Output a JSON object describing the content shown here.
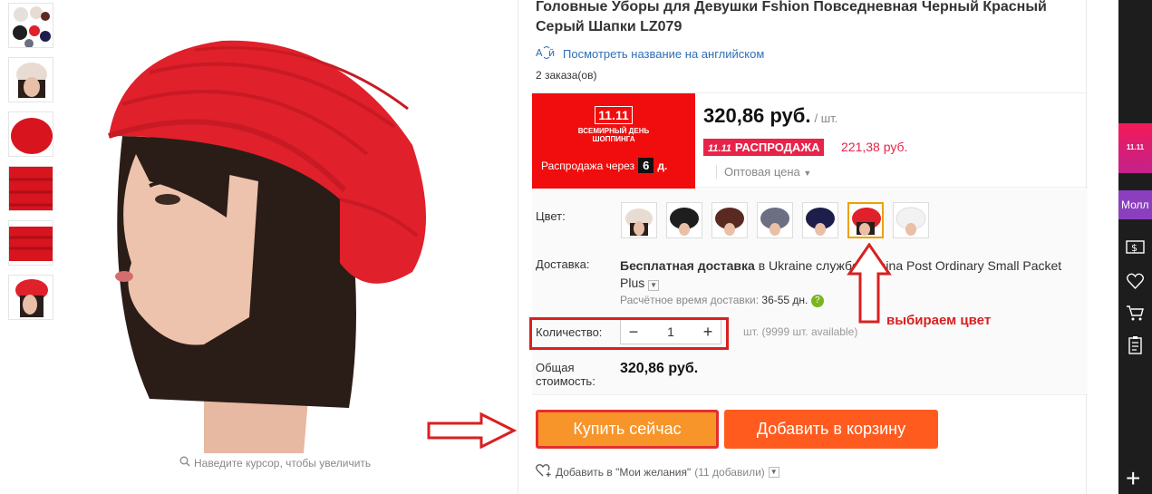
{
  "product": {
    "title": "Головные Уборы для Девушки Fshion Повседневная Черный Красный Серый Шапки LZ079",
    "translate_link": "Посмотреть название на английском",
    "orders": "2 заказа(ов)",
    "zoom_hint": "Наведите курсор, чтобы увеличить",
    "thumbnails": [
      "multi-colors",
      "beige",
      "red-close",
      "red-knit",
      "red-knit-2",
      "red-model"
    ]
  },
  "promo": {
    "logo_top": "11.11",
    "logo_line1": "ВСЕМИРНЫЙ ДЕНЬ",
    "logo_line2": "ШОППИНГА",
    "countdown_label": "Распродажа через",
    "countdown_days": "6",
    "countdown_unit": "д."
  },
  "price": {
    "main": "320,86 руб.",
    "unit": "/ шт.",
    "sale_badge_num": "11.11",
    "sale_badge": "РАСПРОДАЖА",
    "sale_price": "221,38 руб.",
    "wholesale": "Оптовая цена"
  },
  "options": {
    "color_label": "Цвет:",
    "colors": [
      {
        "name": "beige",
        "hex": "#e8dcd2"
      },
      {
        "name": "black",
        "hex": "#1e1e1e"
      },
      {
        "name": "brown",
        "hex": "#5a2a22"
      },
      {
        "name": "grey",
        "hex": "#6c6f82"
      },
      {
        "name": "navy",
        "hex": "#1d1f4a"
      },
      {
        "name": "red",
        "hex": "#e0202a"
      },
      {
        "name": "white",
        "hex": "#f2f2f2"
      }
    ],
    "selected_color": "red",
    "shipping_label": "Доставка:",
    "shipping_text_bold": "Бесплатная доставка",
    "shipping_text_rest": "в Ukraine службой China Post Ordinary Small Packet Plus",
    "shipping_time_label": "Расчётное время доставки:",
    "shipping_time_value": "36-55 дн.",
    "quantity_label": "Количество:",
    "quantity_value": "1",
    "available": "шт. (9999 шт. available)",
    "total_label_1": "Общая",
    "total_label_2": "стоимость:",
    "total_value": "320,86 руб."
  },
  "actions": {
    "buy_now": "Купить сейчас",
    "add_to_cart": "Добавить в корзину",
    "wishlist": "Добавить в \"Мои желания\"",
    "wishlist_count": "(11 добавили)"
  },
  "annotation": {
    "text": "выбираем цвет",
    "color": "#d92020"
  },
  "rail": {
    "promo": "11.11",
    "mall": "Молл"
  }
}
